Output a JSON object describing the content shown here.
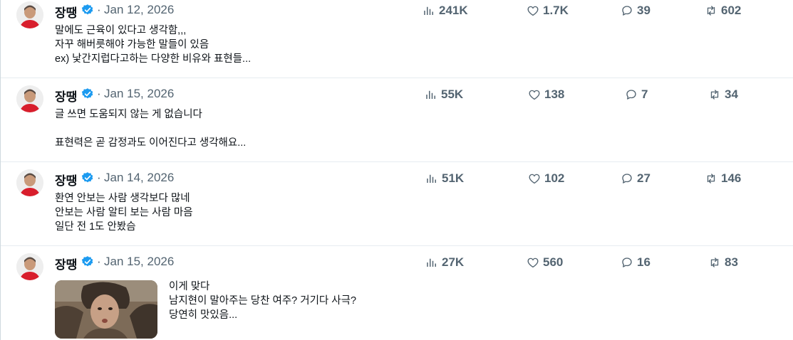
{
  "posts": [
    {
      "author": "장땡",
      "date": "Jan 12, 2026",
      "text": "말에도 근육이 있다고 생각함,,,\n자꾸 해버릇해야 가능한 말들이 있음\nex) 낯간지럽다고하는 다양한 비유와 표현들...",
      "views": "241K",
      "likes": "1.7K",
      "replies": "39",
      "reposts": "602"
    },
    {
      "author": "장땡",
      "date": "Jan 15, 2026",
      "text": "글 쓰면 도움되지 않는 게 없습니다\n\n표현력은 곧 감정과도 이어진다고 생각해요...",
      "views": "55K",
      "likes": "138",
      "replies": "7",
      "reposts": "34"
    },
    {
      "author": "장땡",
      "date": "Jan 14, 2026",
      "text": "환연 안보는 사람 생각보다 많네\n안보는 사람 알티 보는 사람 마음\n일단 전 1도 안봤슴",
      "views": "51K",
      "likes": "102",
      "replies": "27",
      "reposts": "146"
    },
    {
      "author": "장땡",
      "date": "Jan 15, 2026",
      "text": "이게 맞다\n남지현이 말아주는 당찬 여주? 거기다 사극?\n당연히 맛있음...",
      "views": "27K",
      "likes": "560",
      "replies": "16",
      "reposts": "83"
    }
  ],
  "separator": "·",
  "colors": {
    "verified": "#1d9bf0",
    "muted": "#536471",
    "text": "#0f1419",
    "divider": "#e6ecf0"
  },
  "icons": [
    "views-icon",
    "like-icon",
    "reply-icon",
    "repost-icon",
    "verified-badge-icon"
  ]
}
